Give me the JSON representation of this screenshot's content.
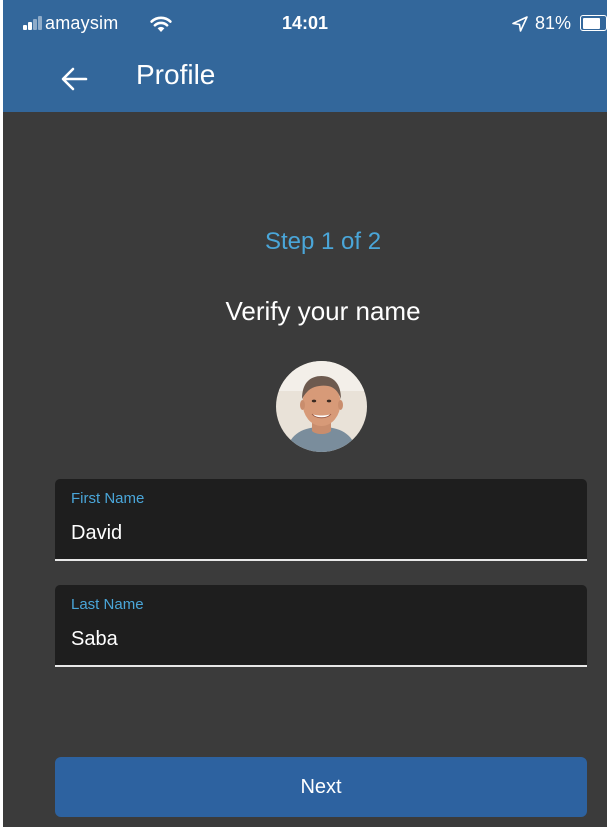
{
  "status_bar": {
    "carrier": "amaysim",
    "time": "14:01",
    "battery_percent": "81%",
    "battery_level": 0.81,
    "icons": [
      "signal-icon",
      "wifi-icon",
      "location-arrow-icon",
      "battery-icon"
    ]
  },
  "header": {
    "title": "Profile",
    "back_icon": "arrow-left-icon"
  },
  "main": {
    "step_label": "Step 1 of 2",
    "heading": "Verify your name"
  },
  "form": {
    "first_name": {
      "label": "First Name",
      "value": "David"
    },
    "last_name": {
      "label": "Last Name",
      "value": "Saba"
    }
  },
  "actions": {
    "next_label": "Next"
  },
  "colors": {
    "header_bg": "#33679b",
    "screen_bg": "#3b3b3b",
    "accent": "#4aa6d9",
    "field_bg": "#1e1e1e",
    "button_bg": "#2d62a0"
  }
}
